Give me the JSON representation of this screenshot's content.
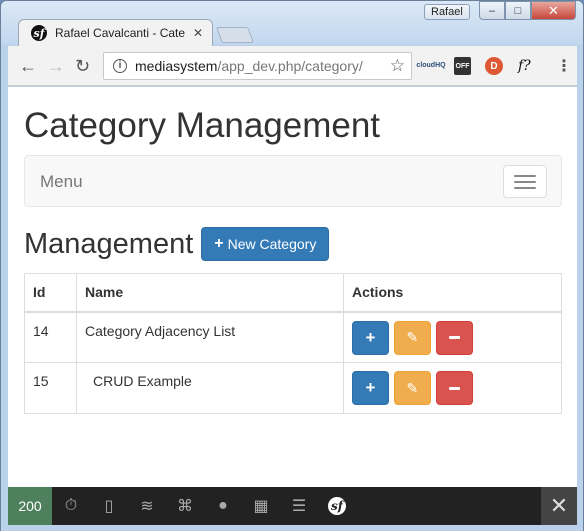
{
  "browser": {
    "profile_name": "Rafael",
    "tab_title": "Rafael Cavalcanti - Categ",
    "url_host": "mediasystem",
    "url_path": "/app_dev.php/category/",
    "extensions": [
      "cloudHQ",
      "OFF",
      "D",
      "f?"
    ]
  },
  "page": {
    "title": "Category Management",
    "navbar_brand": "Menu",
    "section_title": "Management",
    "new_button_label": "New Category",
    "table": {
      "headers": [
        "Id",
        "Name",
        "Actions"
      ],
      "rows": [
        {
          "id": "14",
          "name": "Category Adjacency List"
        },
        {
          "id": "15",
          "name": "CRUD Example"
        }
      ]
    }
  },
  "debug_toolbar": {
    "status_code": "200"
  },
  "colors": {
    "primary": "#337ab7",
    "warning": "#f0ad4e",
    "danger": "#d9534f",
    "status_ok": "#4f805d"
  }
}
